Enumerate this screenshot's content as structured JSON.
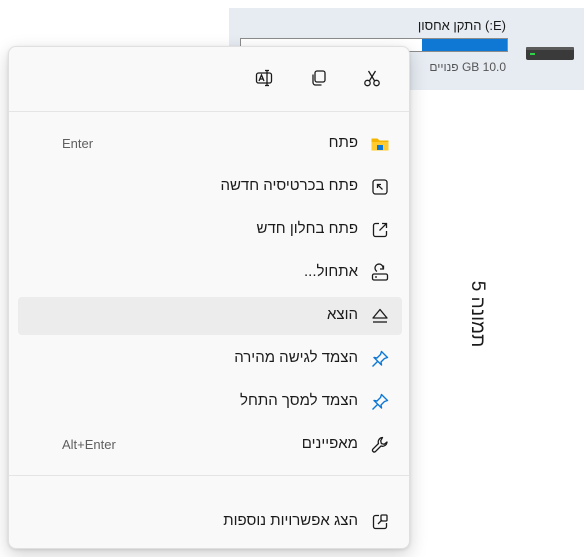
{
  "drive": {
    "title": "(E:) התקן אחסון",
    "free_text": "10.0 GB פנויים",
    "used_fraction": 0.32,
    "icon": "drive-icon"
  },
  "quick_actions": [
    {
      "name": "cut",
      "icon": "scissors-icon"
    },
    {
      "name": "copy",
      "icon": "copy-icon"
    },
    {
      "name": "rename",
      "icon": "rename-icon"
    }
  ],
  "menu": {
    "items": [
      {
        "label": "פתח",
        "shortcut": "Enter",
        "icon": "folder-icon"
      },
      {
        "label": "פתח בכרטיסיה חדשה",
        "shortcut": "",
        "icon": "new-tab-icon"
      },
      {
        "label": "פתח בחלון חדש",
        "shortcut": "",
        "icon": "new-window-icon"
      },
      {
        "label": "אתחול...",
        "shortcut": "",
        "icon": "format-icon"
      },
      {
        "label": "הוצא",
        "shortcut": "",
        "icon": "eject-icon"
      },
      {
        "label": "הצמד לגישה מהירה",
        "shortcut": "",
        "icon": "pin-icon"
      },
      {
        "label": "הצמד למסך התחל",
        "shortcut": "",
        "icon": "pin-icon"
      },
      {
        "label": "מאפיינים",
        "shortcut": "Alt+Enter",
        "icon": "wrench-icon"
      },
      {
        "label": "הצג אפשרויות נוספות",
        "shortcut": "",
        "icon": "more-options-icon"
      }
    ]
  },
  "caption": "תמונה 5",
  "colors": {
    "accent": "#0f78d4",
    "folder": "#f3b500",
    "menu_bg": "#f9f9f9"
  }
}
